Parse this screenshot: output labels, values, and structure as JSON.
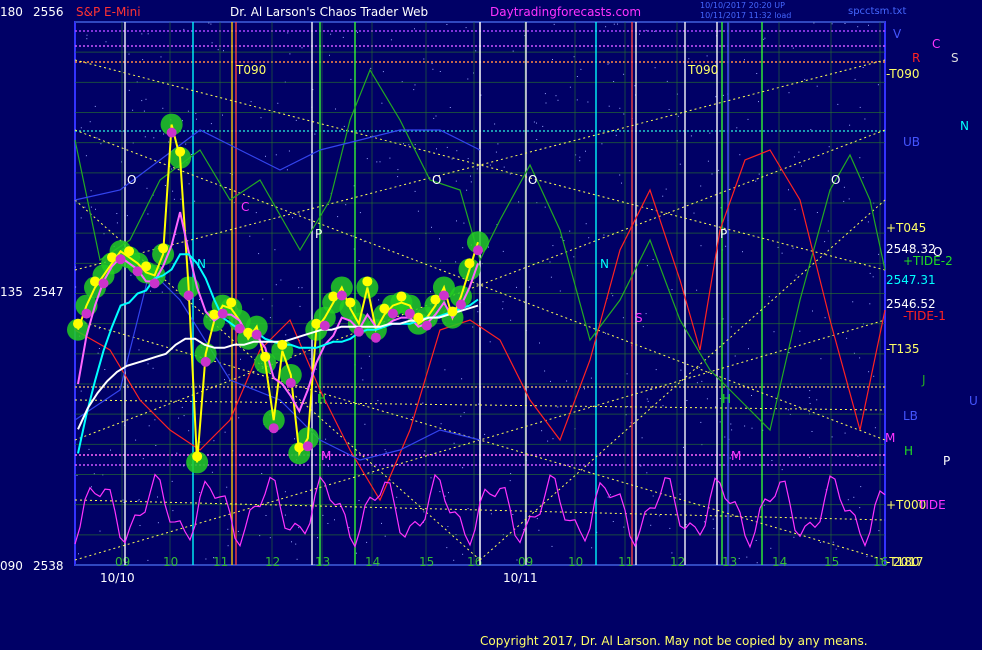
{
  "header": {
    "symbol": "S&P E-Mini",
    "author": "Dr. Al Larson's Chaos Trader Web",
    "site": "Daytradingforecasts.com",
    "timestamp1": "10/10/2017 20:20 UP",
    "timestamp2": "10/11/2017 11:32 load",
    "filename": "spcctsm.txt"
  },
  "footer": {
    "copyright": "Copyright 2017, Dr. Al Larson. May not be copied by any means."
  },
  "colors": {
    "background": "#000066",
    "grid": "#2b7a2b",
    "frame": "#3333ff",
    "price_glow": "#22cc22",
    "price_line": "#ff66ff",
    "ma_fast": "#00ffff",
    "ma_slow": "#ffffff",
    "ma_yellow": "#ffff00",
    "tide_green": "#22aa22",
    "tide_red": "#ff2222",
    "tide_magenta": "#ff33ff"
  },
  "chart_data": {
    "type": "line",
    "y_axis_left": [
      {
        "angle": "180",
        "price": "2556"
      },
      {
        "angle": "135",
        "price": "2547"
      },
      {
        "angle": "090",
        "price": "2538"
      }
    ],
    "ylim": [
      2538,
      2556
    ],
    "hour_ticks": [
      {
        "day": "10/10",
        "hours": [
          "09",
          "10",
          "11",
          "12",
          "13",
          "14",
          "15",
          "16"
        ]
      },
      {
        "day": "10/11",
        "hours": [
          "09",
          "10",
          "11",
          "12",
          "13",
          "14",
          "15",
          "16"
        ]
      }
    ],
    "date_labels": [
      "10/10",
      "10/11"
    ],
    "right_labels": [
      {
        "text": "V",
        "color": "#4455ff"
      },
      {
        "text": "C",
        "color": "#ff33ff"
      },
      {
        "text": "R",
        "color": "#ff2222"
      },
      {
        "text": "S",
        "color": "#dddddd"
      },
      {
        "text": "-T090",
        "color": "#ffff66"
      },
      {
        "text": "N",
        "color": "#00ffff"
      },
      {
        "text": "UB",
        "color": "#4455ff"
      },
      {
        "text": "+T045",
        "color": "#ffff66"
      },
      {
        "text": "2548.32",
        "color": "#ffffff"
      },
      {
        "text": "O",
        "color": "#ffffff"
      },
      {
        "text": "+TIDE-2",
        "color": "#22dd22"
      },
      {
        "text": "2547.31",
        "color": "#00ffff"
      },
      {
        "text": "2546.52",
        "color": "#ffffff"
      },
      {
        "text": "-TIDE-1",
        "color": "#ff2222"
      },
      {
        "text": "-T135",
        "color": "#ffff66"
      },
      {
        "text": "J",
        "color": "#22aa22"
      },
      {
        "text": "U",
        "color": "#4455ff"
      },
      {
        "text": "LB",
        "color": "#4455ff"
      },
      {
        "text": "M",
        "color": "#ff33ff"
      },
      {
        "text": "H",
        "color": "#22dd22"
      },
      {
        "text": "P",
        "color": "#ffffff"
      },
      {
        "text": "+T000",
        "color": "#ffff66"
      },
      {
        "text": "TIDE",
        "color": "#ff33ff"
      },
      {
        "text": "-T180",
        "color": "#ffff66"
      },
      {
        "text": "2017",
        "color": "#ffff66"
      }
    ],
    "in_chart_labels": [
      {
        "text": "T090",
        "color": "#ffff66"
      },
      {
        "text": "T090",
        "color": "#ffff66"
      },
      {
        "text": "O",
        "color": "#ffffff"
      },
      {
        "text": "O",
        "color": "#ffffff"
      },
      {
        "text": "O",
        "color": "#ffffff"
      },
      {
        "text": "O",
        "color": "#ffffff"
      },
      {
        "text": "C",
        "color": "#ff33ff"
      },
      {
        "text": "P",
        "color": "#ffffff"
      },
      {
        "text": "P",
        "color": "#ffffff"
      },
      {
        "text": "N",
        "color": "#00ffff"
      },
      {
        "text": "N",
        "color": "#00ffff"
      },
      {
        "text": "S",
        "color": "#ff33ff"
      },
      {
        "text": "H",
        "color": "#22dd22"
      },
      {
        "text": "H",
        "color": "#22dd22"
      },
      {
        "text": "M",
        "color": "#ff33ff"
      },
      {
        "text": "M",
        "color": "#ff33ff"
      }
    ],
    "series": [
      {
        "values": [
          2545.8,
          2546.6,
          2547.2,
          2547.6,
          2548.0,
          2548.4,
          2548.2,
          2548.0,
          2547.7,
          2547.6,
          2548.3,
          2552.6,
          2551.5,
          2547.2,
          2541.4,
          2545.0,
          2546.1,
          2546.6,
          2546.5,
          2546.1,
          2545.5,
          2545.9,
          2544.7,
          2542.8,
          2545.1,
          2544.3,
          2541.7,
          2542.2,
          2545.8,
          2546.2,
          2546.7,
          2547.2,
          2546.5,
          2546.0,
          2547.2,
          2545.8,
          2546.3,
          2546.6,
          2546.7,
          2546.6,
          2546.0,
          2546.2,
          2546.6,
          2547.2,
          2546.2,
          2546.9,
          2547.8,
          2548.7
        ]
      },
      {
        "values": [
          2544.0,
          2545.6,
          2546.6,
          2547.4,
          2547.9,
          2548.2,
          2548.0,
          2547.8,
          2547.4,
          2547.4,
          2547.9,
          2548.6,
          2549.7,
          2548.4,
          2547.2,
          2546.4,
          2546.1,
          2546.3,
          2546.3,
          2546.1,
          2545.6,
          2545.6,
          2545.2,
          2544.2,
          2544.0,
          2543.6,
          2543.1,
          2543.8,
          2544.7,
          2545.3,
          2545.6,
          2546.2,
          2546.1,
          2545.8,
          2546.3,
          2545.9,
          2545.9,
          2546.1,
          2546.2,
          2546.2,
          2545.9,
          2546.0,
          2546.3,
          2546.7,
          2546.2,
          2546.6,
          2547.2,
          2548.0
        ]
      },
      {
        "values": [
          2541.7,
          2543.0,
          2544.1,
          2545.1,
          2545.9,
          2546.6,
          2546.7,
          2547.0,
          2547.1,
          2547.5,
          2547.6,
          2547.8,
          2548.3,
          2548.3,
          2548.0,
          2547.5,
          2546.8,
          2546.2,
          2546.0,
          2545.8,
          2545.7,
          2545.7,
          2545.5,
          2545.4,
          2545.3,
          2545.3,
          2545.2,
          2545.2,
          2545.2,
          2545.3,
          2545.4,
          2545.4,
          2545.5,
          2545.7,
          2545.8,
          2545.8,
          2545.9,
          2546.0,
          2546.0,
          2546.0,
          2546.1,
          2546.2,
          2546.2,
          2546.3,
          2546.4,
          2546.5,
          2546.6,
          2546.8
        ]
      },
      {
        "values": [
          2542.5,
          2543.2,
          2543.7,
          2544.1,
          2544.4,
          2544.6,
          2544.7,
          2544.8,
          2544.9,
          2545.0,
          2545.3,
          2545.5,
          2545.5,
          2545.3,
          2545.2,
          2545.2,
          2545.3,
          2545.3,
          2545.4,
          2545.4,
          2545.4,
          2545.4,
          2545.5,
          2545.6,
          2545.7,
          2545.8,
          2545.8,
          2545.9,
          2545.9,
          2545.9,
          2545.9,
          2545.9,
          2546.0,
          2546.0,
          2546.1,
          2546.1,
          2546.2,
          2546.2,
          2546.3,
          2546.4,
          2546.5,
          2546.6
        ]
      }
    ]
  }
}
